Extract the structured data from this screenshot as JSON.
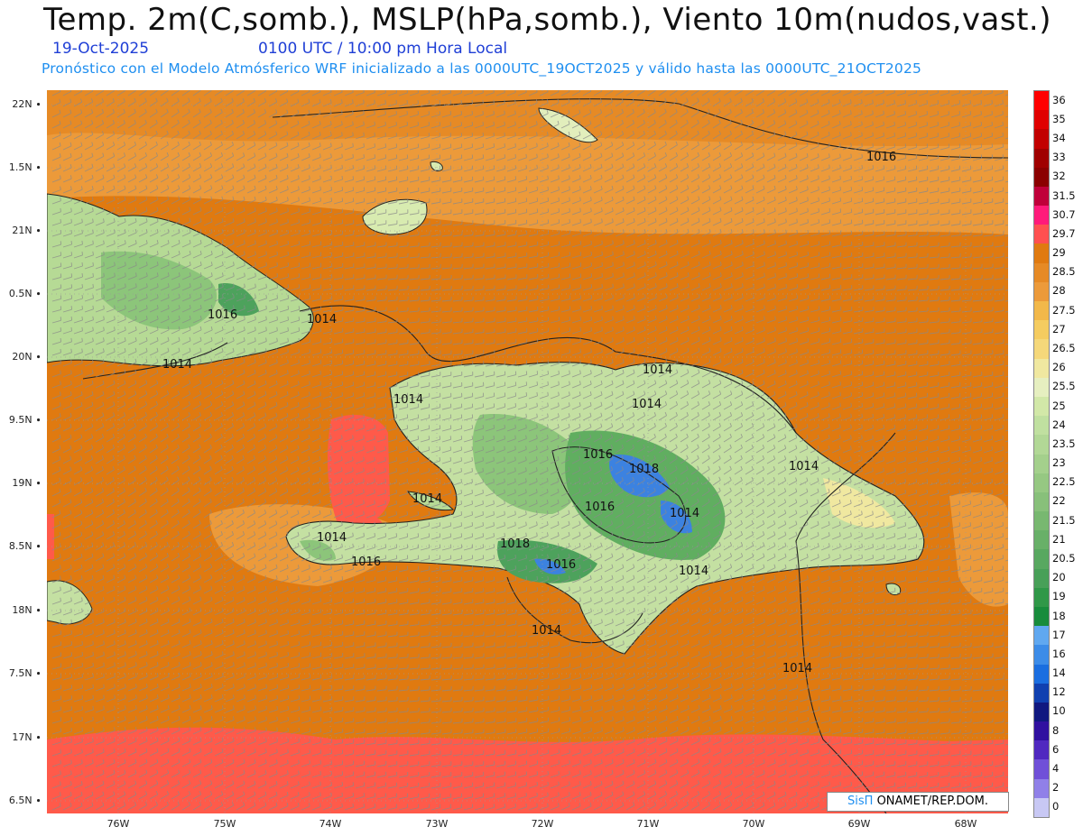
{
  "header": {
    "title": "Temp. 2m(C,somb.), MSLP(hPa,somb.), Viento 10m(nudos,vast.)",
    "date": "19-Oct-2025",
    "time": "0100 UTC / 10:00 pm Hora Local",
    "subtitle": "Pronóstico con el Modelo Atmósferico WRF inicializado a las 0000UTC_19OCT2025 y válido hasta las  0000UTC_21OCT2025"
  },
  "axes": {
    "lat_labels": [
      "22N",
      "1.5N",
      "21N",
      "0.5N",
      "20N",
      "9.5N",
      "19N",
      "8.5N",
      "18N",
      "7.5N",
      "17N",
      "6.5N"
    ],
    "lon_labels": [
      "76W",
      "75W",
      "74W",
      "73W",
      "72W",
      "71W",
      "70W",
      "69W",
      "68W"
    ],
    "lon_range": [
      -76.6,
      -67.6
    ],
    "lat_range": [
      16.4,
      22.1
    ]
  },
  "legend": {
    "labels": [
      "36",
      "35",
      "34",
      "33",
      "32",
      "31.5",
      "30.7",
      "29.7",
      "29",
      "28.5",
      "28",
      "27.5",
      "27",
      "26.5",
      "26",
      "25.5",
      "25",
      "24",
      "23.5",
      "23",
      "22.5",
      "22",
      "21.5",
      "21",
      "20.5",
      "20",
      "19",
      "18",
      "17",
      "16",
      "14",
      "12",
      "10",
      "8",
      "6",
      "4",
      "2",
      "0"
    ],
    "colors": [
      "#ff0000",
      "#e00000",
      "#c20000",
      "#a00000",
      "#8b0000",
      "#c0003a",
      "#ff1a7a",
      "#ff5050",
      "#e07a10",
      "#e68a25",
      "#ec9a3a",
      "#f2b84a",
      "#f5cc60",
      "#f5d87a",
      "#f0e8a0",
      "#e6efc0",
      "#d2e8a8",
      "#c0e0a0",
      "#b2d896",
      "#a4d08c",
      "#96c882",
      "#88c07a",
      "#78b870",
      "#68b068",
      "#58a860",
      "#48a058",
      "#309848",
      "#188c3c",
      "#60a8f0",
      "#3c8ce8",
      "#1a6ee0",
      "#1040b0",
      "#101880",
      "#3010a0",
      "#5028c0",
      "#7050d8",
      "#9080e8",
      "#c8c8f4"
    ]
  },
  "isobars": [
    {
      "label": "1016"
    },
    {
      "label": "1016"
    },
    {
      "label": "1014"
    },
    {
      "label": "1014"
    },
    {
      "label": "1014"
    },
    {
      "label": "1014"
    },
    {
      "label": "1014"
    },
    {
      "label": "1016"
    },
    {
      "label": "1018"
    },
    {
      "label": "1014"
    },
    {
      "label": "1014"
    },
    {
      "label": "1016"
    },
    {
      "label": "1014"
    },
    {
      "label": "1014"
    },
    {
      "label": "1016"
    },
    {
      "label": "1018"
    },
    {
      "label": "1016"
    },
    {
      "label": "1014"
    },
    {
      "label": "1014"
    },
    {
      "label": "1014"
    }
  ],
  "credit": {
    "logo": "SisΠ",
    "text": " ONAMET/REP.DOM."
  }
}
